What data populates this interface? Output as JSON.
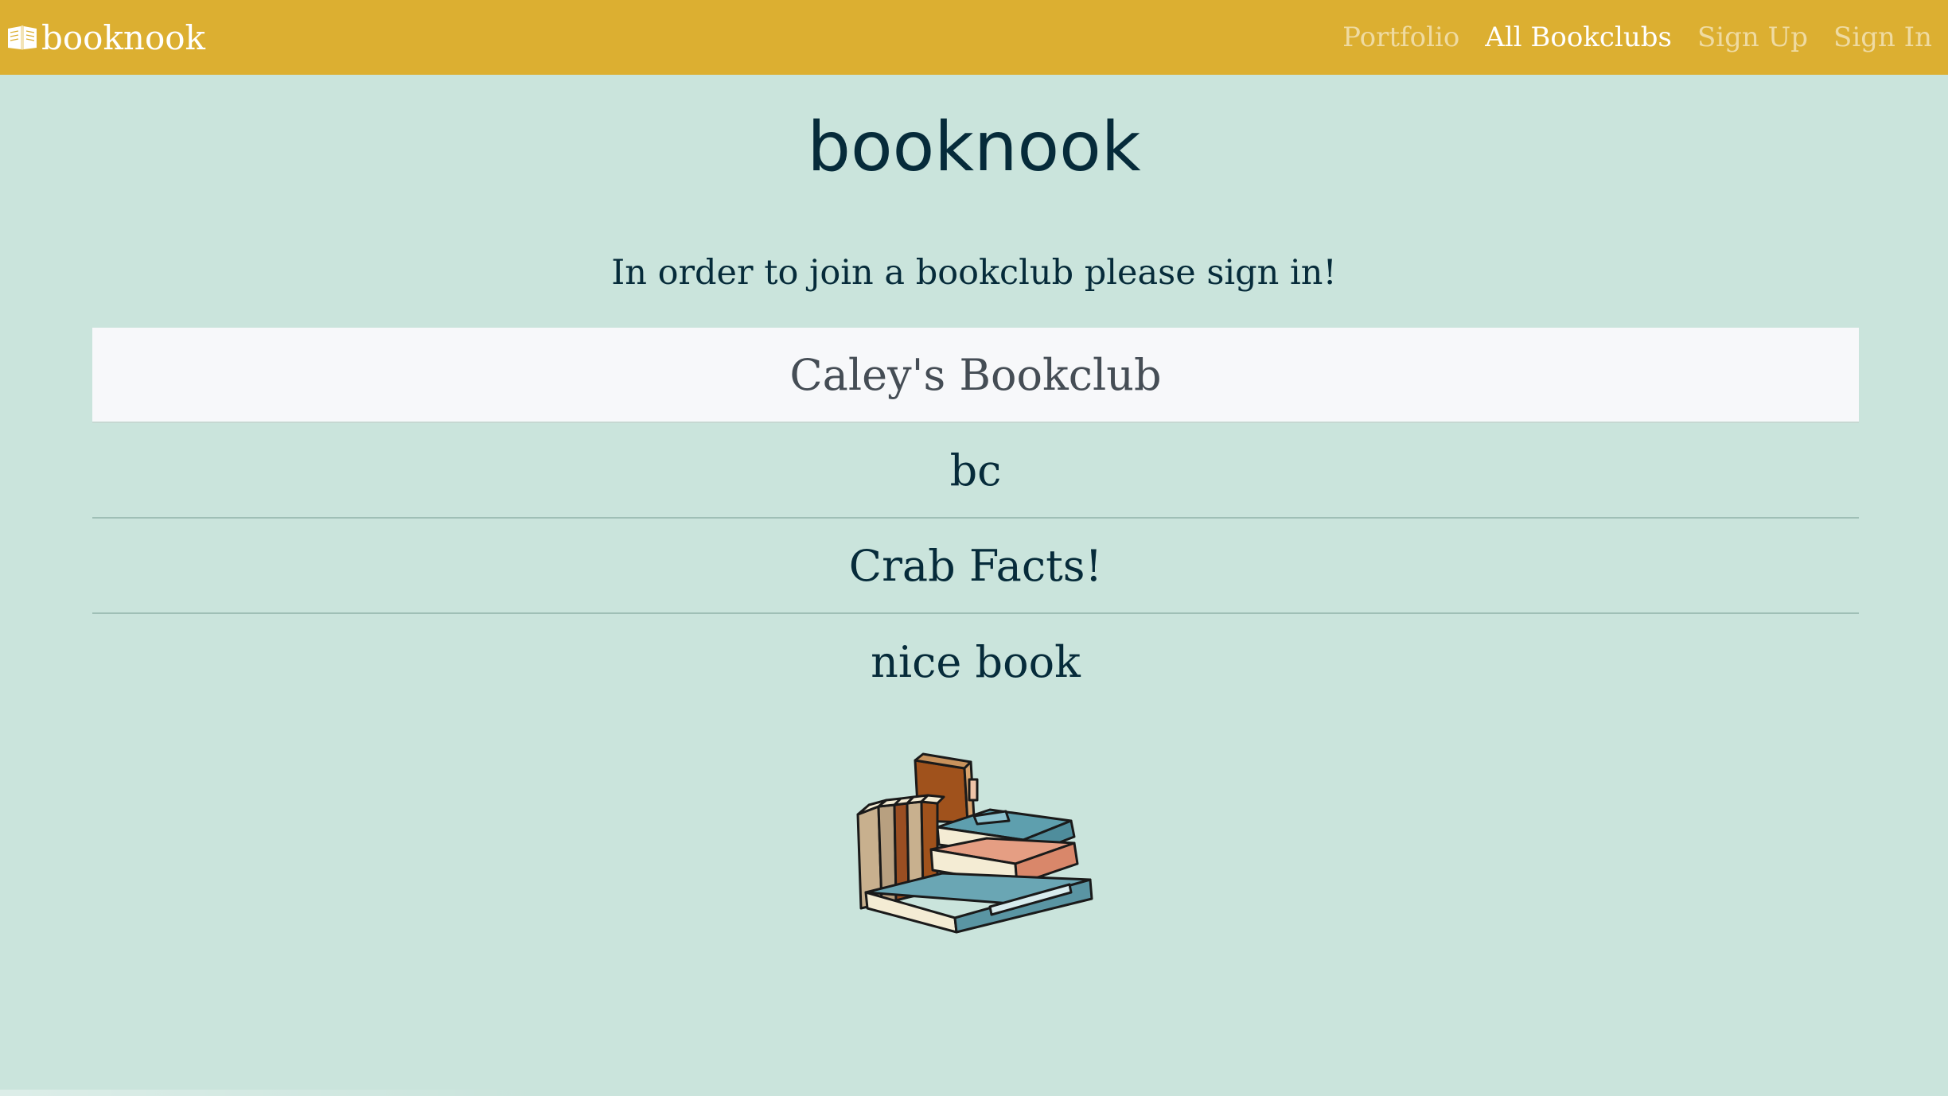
{
  "navbar": {
    "brand_label": "booknook",
    "brand_icon": "open-book-icon",
    "links": [
      {
        "label": "Portfolio",
        "active": false
      },
      {
        "label": "All Bookclubs",
        "active": true
      },
      {
        "label": "Sign Up",
        "active": false
      },
      {
        "label": "Sign In",
        "active": false
      }
    ]
  },
  "main": {
    "title": "booknook",
    "message": "In order to join a bookclub please sign in!",
    "bookclubs": [
      {
        "name": "Caley's Bookclub"
      },
      {
        "name": "bc"
      },
      {
        "name": "Crab Facts!"
      },
      {
        "name": "nice book"
      }
    ],
    "illustration": "stack-of-books-illustration"
  },
  "colors": {
    "navbar": "#dcaf31",
    "background": "#cae4dc",
    "text": "#062b3a",
    "highlight_row": "#f7f8fa"
  }
}
